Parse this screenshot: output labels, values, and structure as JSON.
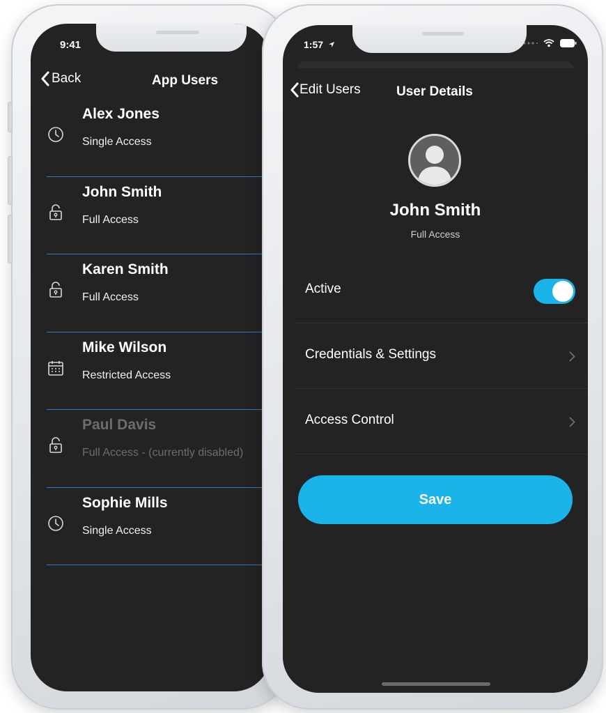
{
  "left_phone": {
    "status_time": "9:41",
    "nav": {
      "back_label": "Back",
      "title": "App Users"
    },
    "users": [
      {
        "name": "Alex Jones",
        "access": "Single Access",
        "icon": "clock-icon",
        "disabled": false
      },
      {
        "name": "John Smith",
        "access": "Full Access",
        "icon": "lock-icon",
        "disabled": false
      },
      {
        "name": "Karen Smith",
        "access": "Full Access",
        "icon": "lock-icon",
        "disabled": false
      },
      {
        "name": "Mike Wilson",
        "access": "Restricted Access",
        "icon": "calendar-icon",
        "disabled": false
      },
      {
        "name": "Paul Davis",
        "access": "Full Access - (currently disabled)",
        "icon": "lock-icon",
        "disabled": true
      },
      {
        "name": "Sophie Mills",
        "access": "Single Access",
        "icon": "clock-icon",
        "disabled": false
      }
    ]
  },
  "right_phone": {
    "status_time": "1:57",
    "nav": {
      "back_label": "Edit Users",
      "title": "User Details"
    },
    "user": {
      "name": "John Smith",
      "access": "Full Access",
      "avatar_icon": "user-silhouette-icon"
    },
    "settings": {
      "active_label": "Active",
      "active_on": true,
      "credentials_label": "Credentials & Settings",
      "access_control_label": "Access Control"
    },
    "save_label": "Save"
  },
  "colors": {
    "screen_bg": "#232323",
    "accent": "#1ab4ea",
    "divider_blue": "#2f78c8",
    "disabled_text": "#6d6d6d"
  }
}
